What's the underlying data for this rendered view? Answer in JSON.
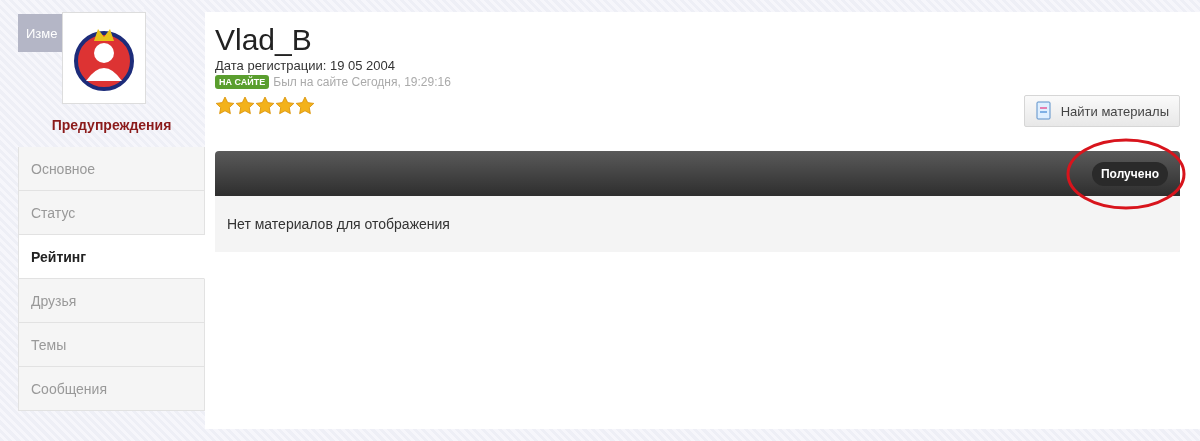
{
  "sidebar": {
    "edit_button": "Изме",
    "warnings_link": "Предупреждения",
    "items": [
      {
        "label": "Основное",
        "selected": false
      },
      {
        "label": "Статус",
        "selected": false
      },
      {
        "label": "Рейтинг",
        "selected": true
      },
      {
        "label": "Друзья",
        "selected": false
      },
      {
        "label": "Темы",
        "selected": false
      },
      {
        "label": "Сообщения",
        "selected": false
      }
    ]
  },
  "profile": {
    "username": "Vlad_B",
    "registration": "Дата регистрации: 19 05 2004",
    "online_badge": "НА САЙТЕ",
    "last_seen": "Был на сайте Сегодня, 19:29:16",
    "stars": 5
  },
  "find_button": "Найти материалы",
  "tabs_bar": {
    "tabs": [
      {
        "label": "Получено",
        "selected": true,
        "highlighted": true
      }
    ]
  },
  "empty_message": "Нет материалов для отображения"
}
